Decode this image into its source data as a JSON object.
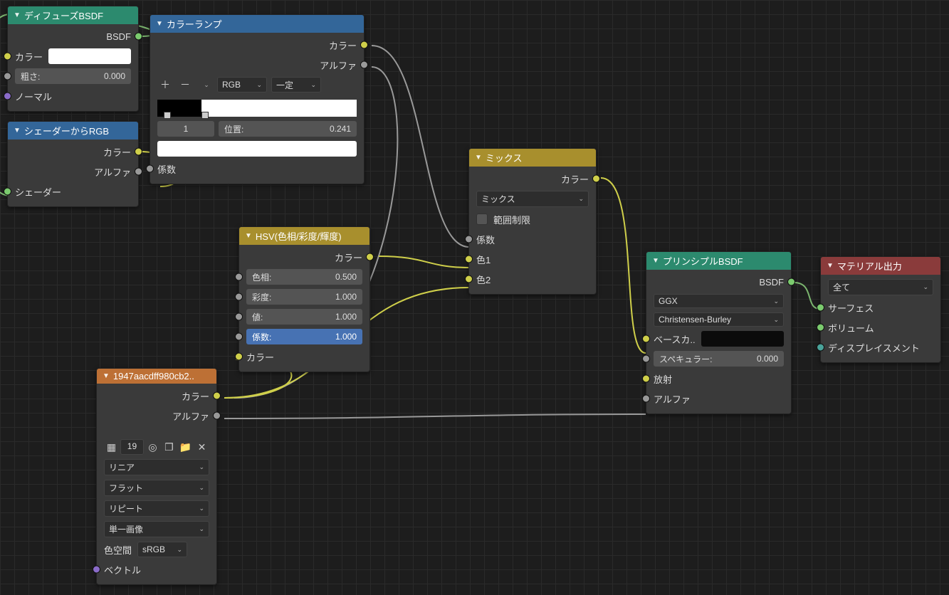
{
  "nodes": {
    "diffuse": {
      "title": "ディフューズBSDF",
      "out_bsdf": "BSDF",
      "in_color": "カラー",
      "roughness_label": "粗さ:",
      "roughness_value": "0.000",
      "in_normal": "ノーマル"
    },
    "shader_rgb": {
      "title": "シェーダーからRGB",
      "out_color": "カラー",
      "out_alpha": "アルファ",
      "in_shader": "シェーダー"
    },
    "color_ramp": {
      "title": "カラーランプ",
      "out_color": "カラー",
      "out_alpha": "アルファ",
      "mode": "RGB",
      "interp": "一定",
      "index": "1",
      "pos_label": "位置:",
      "pos_value": "0.241",
      "in_fac": "係数"
    },
    "hsv": {
      "title": "HSV(色相/彩度/輝度)",
      "out_color": "カラー",
      "hue_label": "色相:",
      "hue_value": "0.500",
      "sat_label": "彩度:",
      "sat_value": "1.000",
      "val_label": "値:",
      "val_value": "1.000",
      "fac_label": "係数:",
      "fac_value": "1.000",
      "in_color": "カラー"
    },
    "mix": {
      "title": "ミックス",
      "out_color": "カラー",
      "blend": "ミックス",
      "clamp": "範囲制限",
      "in_fac": "係数",
      "in_color1": "色1",
      "in_color2": "色2"
    },
    "imgtex": {
      "title": "1947aacdff980cb2..",
      "out_color": "カラー",
      "out_alpha": "アルファ",
      "img_users": "19",
      "interp": "リニア",
      "proj": "フラット",
      "ext": "リピート",
      "source": "単一画像",
      "cs_label": "色空間",
      "cs_value": "sRGB",
      "in_vector": "ベクトル"
    },
    "principled": {
      "title": "プリンシプルBSDF",
      "out_bsdf": "BSDF",
      "dist": "GGX",
      "sss": "Christensen-Burley",
      "base_color": "ベースカ..",
      "spec_label": "スペキュラー:",
      "spec_value": "0.000",
      "emission": "放射",
      "alpha": "アルファ"
    },
    "output": {
      "title": "マテリアル出力",
      "target": "全て",
      "surface": "サーフェス",
      "volume": "ボリューム",
      "displacement": "ディスプレイスメント"
    }
  }
}
